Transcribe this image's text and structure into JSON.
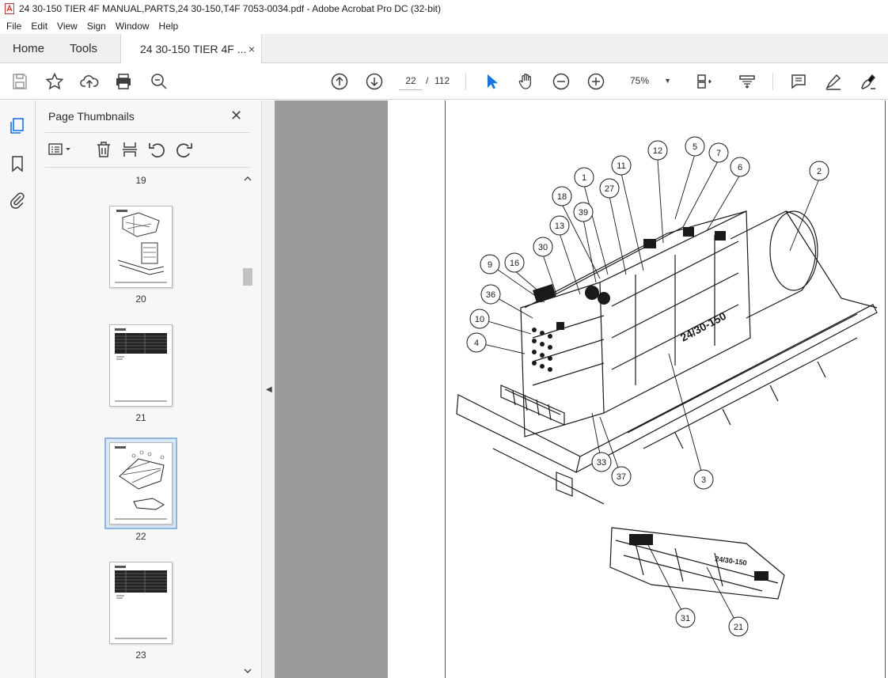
{
  "window": {
    "title": "24 30-150 TIER 4F MANUAL,PARTS,24 30-150,T4F 7053-0034.pdf - Adobe Acrobat Pro DC (32-bit)"
  },
  "menu": [
    "File",
    "Edit",
    "View",
    "Sign",
    "Window",
    "Help"
  ],
  "tabs": {
    "home": "Home",
    "tools": "Tools",
    "document": "24 30-150 TIER 4F ...",
    "close": "×"
  },
  "toolbar": {
    "current_page": "22",
    "page_separator": "/",
    "total_pages": "112",
    "zoom": "75%",
    "icons": [
      "save-icon",
      "star-icon",
      "upload-icon",
      "print-icon",
      "search-zoom-icon",
      "page-up-icon",
      "page-down-icon",
      "select-pointer-icon",
      "hand-icon",
      "zoom-out-icon",
      "zoom-in-icon",
      "fit-page-icon",
      "scroll-mode-icon",
      "comment-icon",
      "highlight-icon",
      "sign-icon"
    ]
  },
  "thumbnails_panel": {
    "title": "Page Thumbnails",
    "close": "✕",
    "pages": [
      {
        "label": "19",
        "selected": false
      },
      {
        "label": "20",
        "selected": false
      },
      {
        "label": "21",
        "selected": false
      },
      {
        "label": "22",
        "selected": true
      },
      {
        "label": "23",
        "selected": false
      }
    ]
  },
  "drawing": {
    "callouts": [
      "12",
      "5",
      "7",
      "6",
      "2",
      "11",
      "1",
      "27",
      "18",
      "39",
      "13",
      "30",
      "9",
      "16",
      "36",
      "10",
      "4",
      "33",
      "37",
      "3",
      "31",
      "21"
    ],
    "model_text": "24/30-150"
  }
}
